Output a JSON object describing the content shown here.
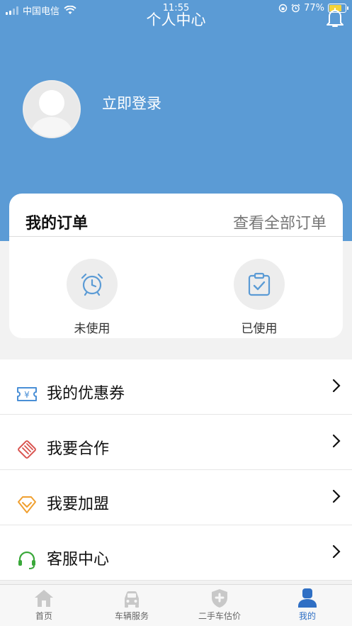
{
  "status_bar": {
    "carrier": "中国电信",
    "time": "11:55",
    "battery_percent": "77%",
    "battery_level": 0.77
  },
  "header": {
    "title": "个人中心",
    "login_text": "立即登录"
  },
  "orders": {
    "title": "我的订单",
    "view_all": "查看全部订单",
    "items": [
      {
        "label": "未使用",
        "icon": "alarm-clock-icon"
      },
      {
        "label": "已使用",
        "icon": "clipboard-check-icon"
      }
    ]
  },
  "menu": {
    "items": [
      {
        "label": "我的优惠券",
        "icon": "coupon-icon"
      },
      {
        "label": "我要合作",
        "icon": "handshake-icon"
      },
      {
        "label": "我要加盟",
        "icon": "diamond-icon"
      },
      {
        "label": "客服中心",
        "icon": "headset-icon"
      }
    ]
  },
  "tabbar": {
    "items": [
      {
        "label": "首页",
        "icon": "home-icon"
      },
      {
        "label": "车辆服务",
        "icon": "car-icon"
      },
      {
        "label": "二手车估价",
        "icon": "shield-plus-icon"
      },
      {
        "label": "我的",
        "icon": "user-icon",
        "active": true
      }
    ]
  },
  "colors": {
    "header_blue": "#5b9bd5",
    "icon_blue": "#5b9bd5",
    "coupon_blue": "#4a8fd6",
    "handshake_red": "#d9534f",
    "diamond_orange": "#f0a030",
    "headset_green": "#3aa83a",
    "tab_active": "#2f6fc4",
    "tab_inactive": "#c8c8c8"
  }
}
